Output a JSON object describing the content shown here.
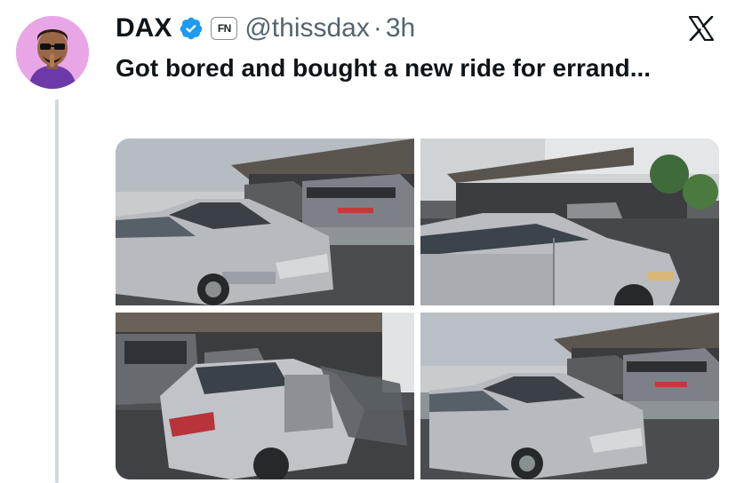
{
  "author": {
    "display_name": "DAX",
    "handle": "@thissdax",
    "separator": "·",
    "time_ago": "3h",
    "affiliate_badge": "FN",
    "avatar_icon": "avatar-cartoon-man-sunglasses",
    "verified_icon": "verified-badge-icon"
  },
  "tweet": {
    "text": "Got bored and bought a new ride for errand..."
  },
  "media": {
    "photos": [
      {
        "icon": "silver-sedan-front-photo"
      },
      {
        "icon": "silver-sedan-side-photo"
      },
      {
        "icon": "silver-sedan-rear-open-door-photo"
      },
      {
        "icon": "silver-sedan-front-photo"
      }
    ]
  },
  "colors": {
    "text_primary": "#0f1419",
    "text_secondary": "#536471",
    "verified_blue": "#1d9bf0",
    "avatar_bg": "#e9a6e6"
  }
}
